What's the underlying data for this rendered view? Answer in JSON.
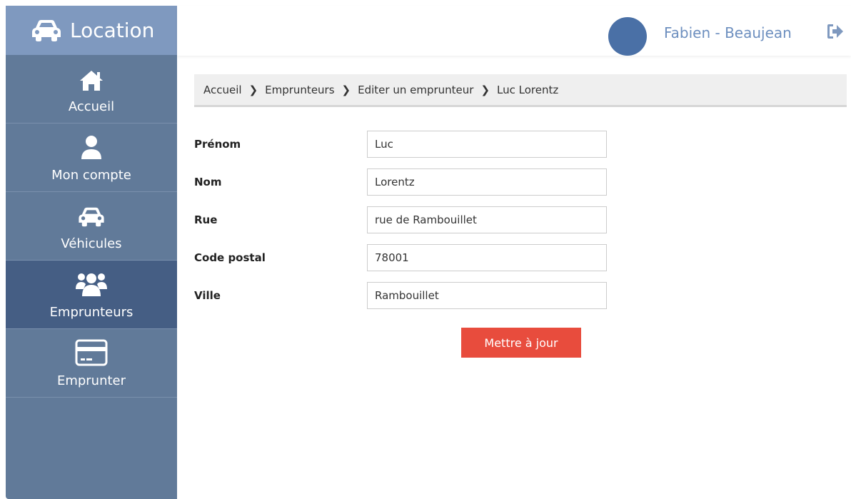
{
  "app": {
    "title": "Location"
  },
  "sidebar": {
    "items": [
      {
        "label": "Accueil",
        "icon": "home-icon",
        "active": false
      },
      {
        "label": "Mon compte",
        "icon": "user-icon",
        "active": false
      },
      {
        "label": "Véhicules",
        "icon": "car-icon",
        "active": false
      },
      {
        "label": "Emprunteurs",
        "icon": "users-icon",
        "active": true
      },
      {
        "label": "Emprunter",
        "icon": "credit-card-icon",
        "active": false
      }
    ]
  },
  "header": {
    "username": "Fabien - Beaujean",
    "logout_icon": "sign-out-icon"
  },
  "breadcrumb": [
    "Accueil",
    "Emprunteurs",
    "Editer un emprunteur",
    "Luc Lorentz"
  ],
  "form": {
    "fields": [
      {
        "label": "Prénom",
        "value": "Luc"
      },
      {
        "label": "Nom",
        "value": "Lorentz"
      },
      {
        "label": "Rue",
        "value": "rue de Rambouillet"
      },
      {
        "label": "Code postal",
        "value": "78001"
      },
      {
        "label": "Ville",
        "value": "Rambouillet"
      }
    ],
    "submit_label": "Mettre à jour"
  },
  "colors": {
    "sidebar": "#617a99",
    "brand": "#7f99bf",
    "active": "#455e84",
    "accent": "#e84c3d",
    "username": "#6d8fbf",
    "avatar": "#4a70a6"
  }
}
